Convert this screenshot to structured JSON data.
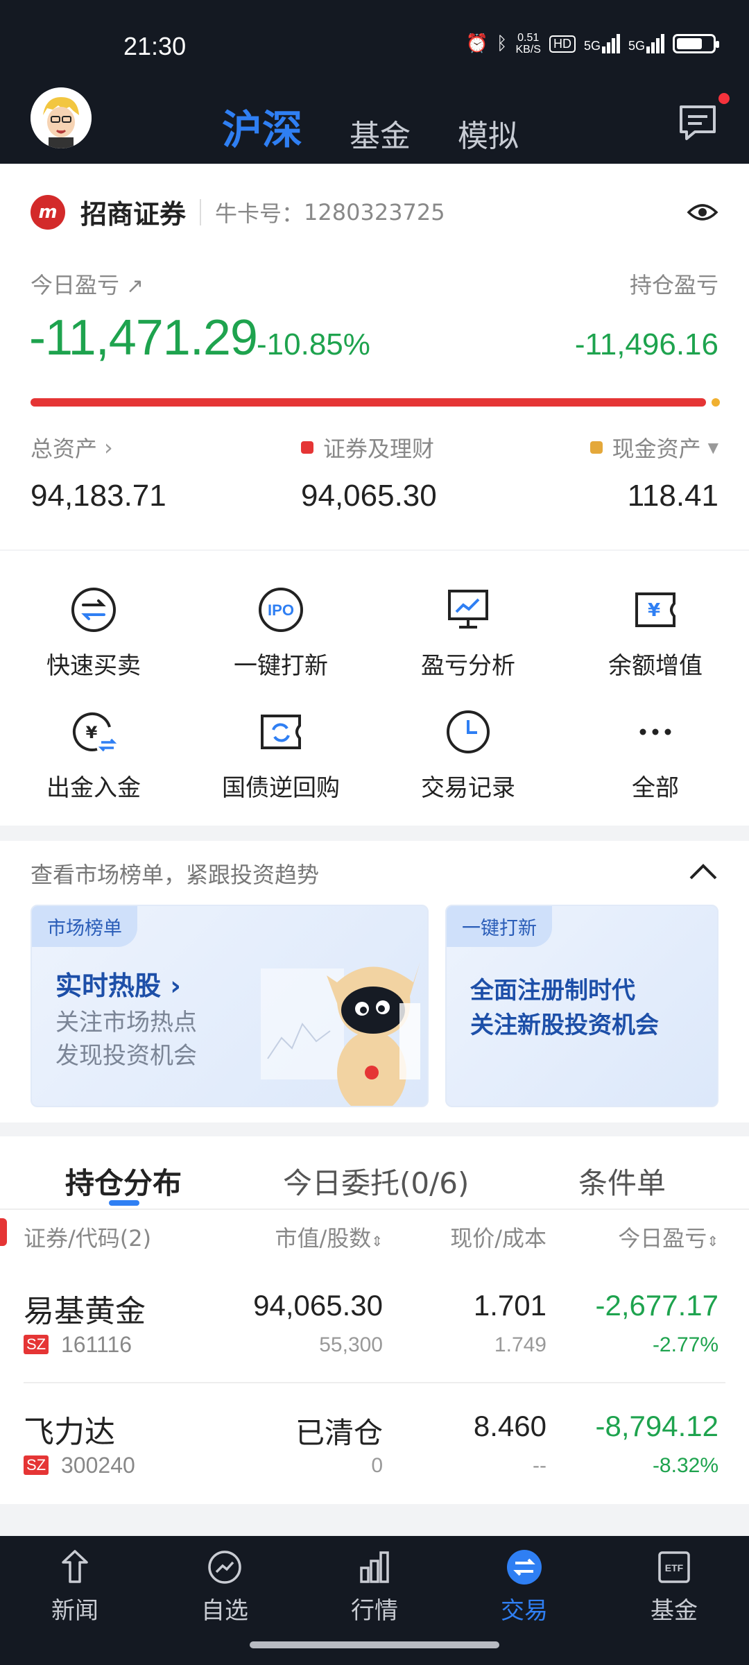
{
  "status_bar": {
    "time": "21:30",
    "net_speed": "0.51",
    "net_unit": "KB/S",
    "hd": "HD",
    "sig1": "5G",
    "sig2": "5G"
  },
  "top_tabs": [
    "沪深",
    "基金",
    "模拟"
  ],
  "account": {
    "broker": "招商证券",
    "account_label": "牛卡号：",
    "account_no": "1280323725",
    "today_pl_label": "今日盈亏",
    "hold_pl_label": "持仓盈亏",
    "today_pl": "-11,471.29",
    "today_pl_pct": "-10.85%",
    "hold_pl": "-11,496.16",
    "total_assets_label": "总资产",
    "total_assets": "94,183.71",
    "securities_label": "证券及理财",
    "securities": "94,065.30",
    "cash_label": "现金资产",
    "cash": "118.41"
  },
  "quick_actions": [
    {
      "label": "快速买卖",
      "icon": "swap-icon"
    },
    {
      "label": "一键打新",
      "icon": "ipo-icon"
    },
    {
      "label": "盈亏分析",
      "icon": "chart-monitor-icon"
    },
    {
      "label": "余额增值",
      "icon": "yuan-ticket-icon"
    },
    {
      "label": "出金入金",
      "icon": "yuan-transfer-icon"
    },
    {
      "label": "国债逆回购",
      "icon": "refresh-ticket-icon"
    },
    {
      "label": "交易记录",
      "icon": "clock-icon"
    },
    {
      "label": "全部",
      "icon": "more-icon"
    }
  ],
  "promo": {
    "header": "查看市场榜单，紧跟投资趋势",
    "card1": {
      "tag": "市场榜单",
      "title": "实时热股",
      "line1": "关注市场热点",
      "line2": "发现投资机会"
    },
    "card2": {
      "tag": "一键打新",
      "line1": "全面注册制时代",
      "line2": "关注新股投资机会"
    }
  },
  "holdings": {
    "tabs": [
      "持仓分布",
      "今日委托(0/6)",
      "条件单"
    ],
    "headers": {
      "name": "证券/代码(2)",
      "value": "市值/股数",
      "price": "现价/成本",
      "pl": "今日盈亏"
    },
    "rows": [
      {
        "name": "易基黄金",
        "market": "SZ",
        "code": "161116",
        "value": "94,065.30",
        "shares": "55,300",
        "price": "1.701",
        "cost": "1.749",
        "pl": "-2,677.17",
        "pl_pct": "-2.77%"
      },
      {
        "name": "飞力达",
        "market": "SZ",
        "code": "300240",
        "value": "已清仓",
        "shares": "0",
        "price": "8.460",
        "cost": "--",
        "pl": "-8,794.12",
        "pl_pct": "-8.32%"
      }
    ]
  },
  "bottom_nav": [
    {
      "label": "新闻",
      "icon": "news-icon"
    },
    {
      "label": "自选",
      "icon": "trend-icon"
    },
    {
      "label": "行情",
      "icon": "bar-chart-icon"
    },
    {
      "label": "交易",
      "icon": "trade-icon"
    },
    {
      "label": "基金",
      "icon": "etf-icon"
    }
  ],
  "colors": {
    "accent": "#2f7ff3",
    "loss": "#1ea34e",
    "header_bg": "#141922",
    "alert": "#e53535",
    "cash_dot": "#f0b030"
  }
}
